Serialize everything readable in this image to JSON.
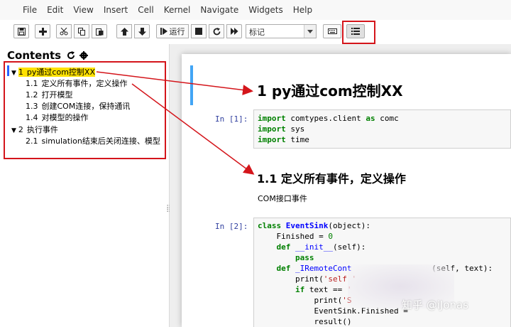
{
  "menubar": {
    "items": [
      "File",
      "Edit",
      "View",
      "Insert",
      "Cell",
      "Kernel",
      "Navigate",
      "Widgets",
      "Help"
    ]
  },
  "toolbar": {
    "run_label": "运行",
    "cell_type": "标记"
  },
  "toc": {
    "title": "Contents",
    "items": [
      {
        "num": "1",
        "label": "py通过com控制XX"
      },
      {
        "num": "1.1",
        "label": "定义所有事件，定义操作"
      },
      {
        "num": "1.2",
        "label": "打开模型"
      },
      {
        "num": "1.3",
        "label": "创建COM连接，保持通讯"
      },
      {
        "num": "1.4",
        "label": "对模型的操作"
      },
      {
        "num": "2",
        "label": "执行事件"
      },
      {
        "num": "2.1",
        "label": "simulation结束后关闭连接、模型"
      }
    ]
  },
  "notebook": {
    "heading1": "1  py通过com控制XX",
    "heading2": "1.1  定义所有事件，定义操作",
    "cell1_prompt": "In  [1]:",
    "cell2_prompt": "In  [2]:",
    "markdown_text": "COM接口事件"
  },
  "watermark": "知乎 @iJonas",
  "colors": {
    "accent_red": "#d4151b",
    "highlight": "#ffe100",
    "cell_bar": "#42a5f5"
  }
}
